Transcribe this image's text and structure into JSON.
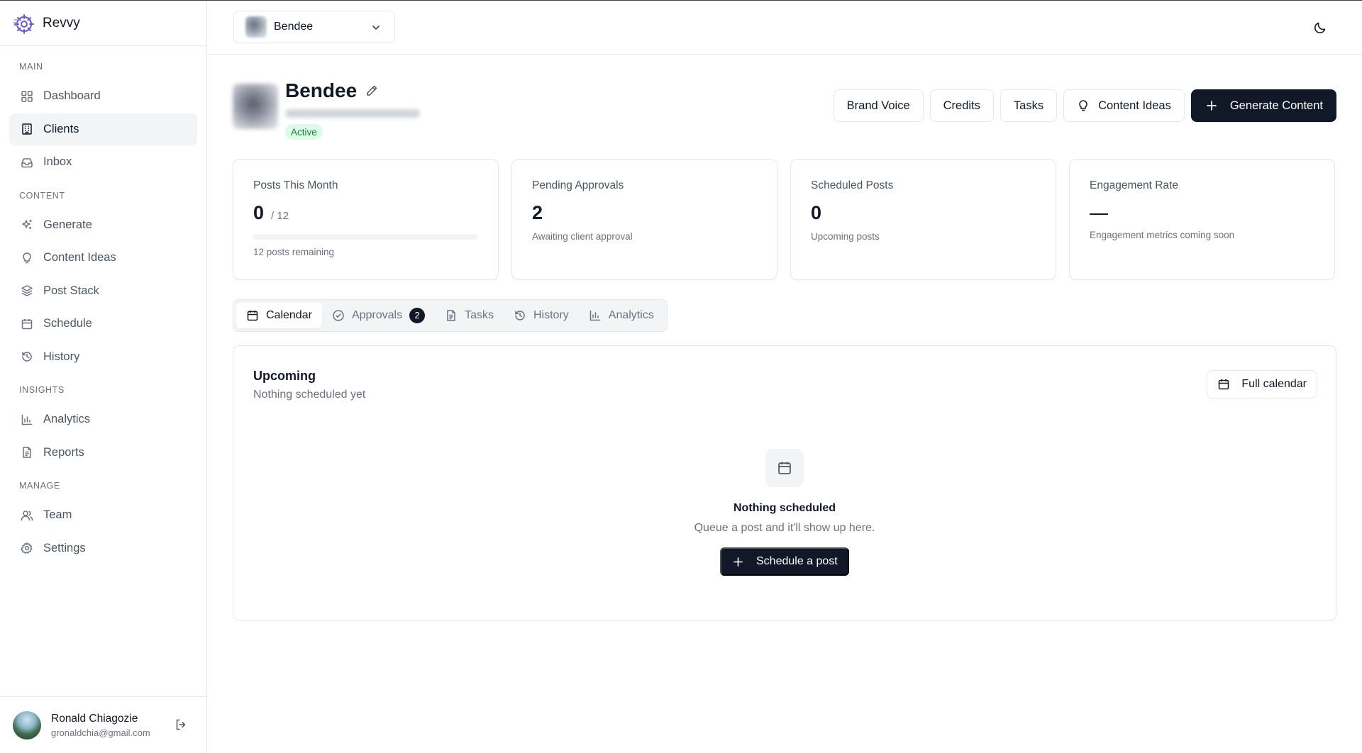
{
  "app": {
    "name": "Revvy"
  },
  "sidebar": {
    "sections": {
      "main": "MAIN",
      "content": "CONTENT",
      "insights": "INSIGHTS",
      "manage": "MANAGE"
    },
    "items": {
      "dashboard": "Dashboard",
      "clients": "Clients",
      "inbox": "Inbox",
      "generate": "Generate",
      "content_ideas": "Content Ideas",
      "post_stack": "Post Stack",
      "schedule": "Schedule",
      "history": "History",
      "analytics": "Analytics",
      "reports": "Reports",
      "team": "Team",
      "settings": "Settings"
    },
    "active": "Clients"
  },
  "user": {
    "name": "Ronald Chiagozie",
    "email": "gronaldchia@gmail.com"
  },
  "topbar": {
    "client_selected": "Bendee"
  },
  "client": {
    "name": "Bendee",
    "status": "Active"
  },
  "actions": {
    "brand_voice": "Brand Voice",
    "credits": "Credits",
    "tasks": "Tasks",
    "content_ideas": "Content Ideas",
    "generate": "Generate Content"
  },
  "stats": {
    "posts_month": {
      "title": "Posts This Month",
      "value": "0",
      "unit": "/ 12",
      "caption": "12 posts remaining",
      "progress": 0
    },
    "pending": {
      "title": "Pending Approvals",
      "value": "2",
      "caption": "Awaiting client approval"
    },
    "scheduled": {
      "title": "Scheduled Posts",
      "value": "0",
      "caption": "Upcoming posts"
    },
    "engagement": {
      "title": "Engagement Rate",
      "caption": "Engagement metrics coming soon"
    }
  },
  "tabs": {
    "calendar": "Calendar",
    "approvals": "Approvals",
    "approvals_count": "2",
    "tasks": "Tasks",
    "history": "History",
    "analytics": "Analytics",
    "active": "Calendar"
  },
  "upcoming": {
    "title": "Upcoming",
    "subtitle": "Nothing scheduled yet",
    "full_calendar": "Full calendar",
    "empty_title": "Nothing scheduled",
    "empty_sub": "Queue a post and it'll show up here.",
    "cta": "Schedule a post"
  },
  "colors": {
    "primary": "#111827",
    "active_badge_bg": "#dcfce7",
    "active_badge_text": "#15803d",
    "brand": "#6d5bd0"
  },
  "icons": {
    "logo": "revvy-logo-icon",
    "dashboard": "grid-icon",
    "clients": "building-icon",
    "inbox": "inbox-icon",
    "generate": "sparkles-icon",
    "content_ideas": "lightbulb-icon",
    "post_stack": "layers-icon",
    "schedule": "calendar-icon",
    "history": "history-icon",
    "analytics": "bar-chart-icon",
    "reports": "document-icon",
    "team": "users-icon",
    "settings": "gear-icon",
    "logout": "logout-icon",
    "theme": "moon-icon"
  }
}
